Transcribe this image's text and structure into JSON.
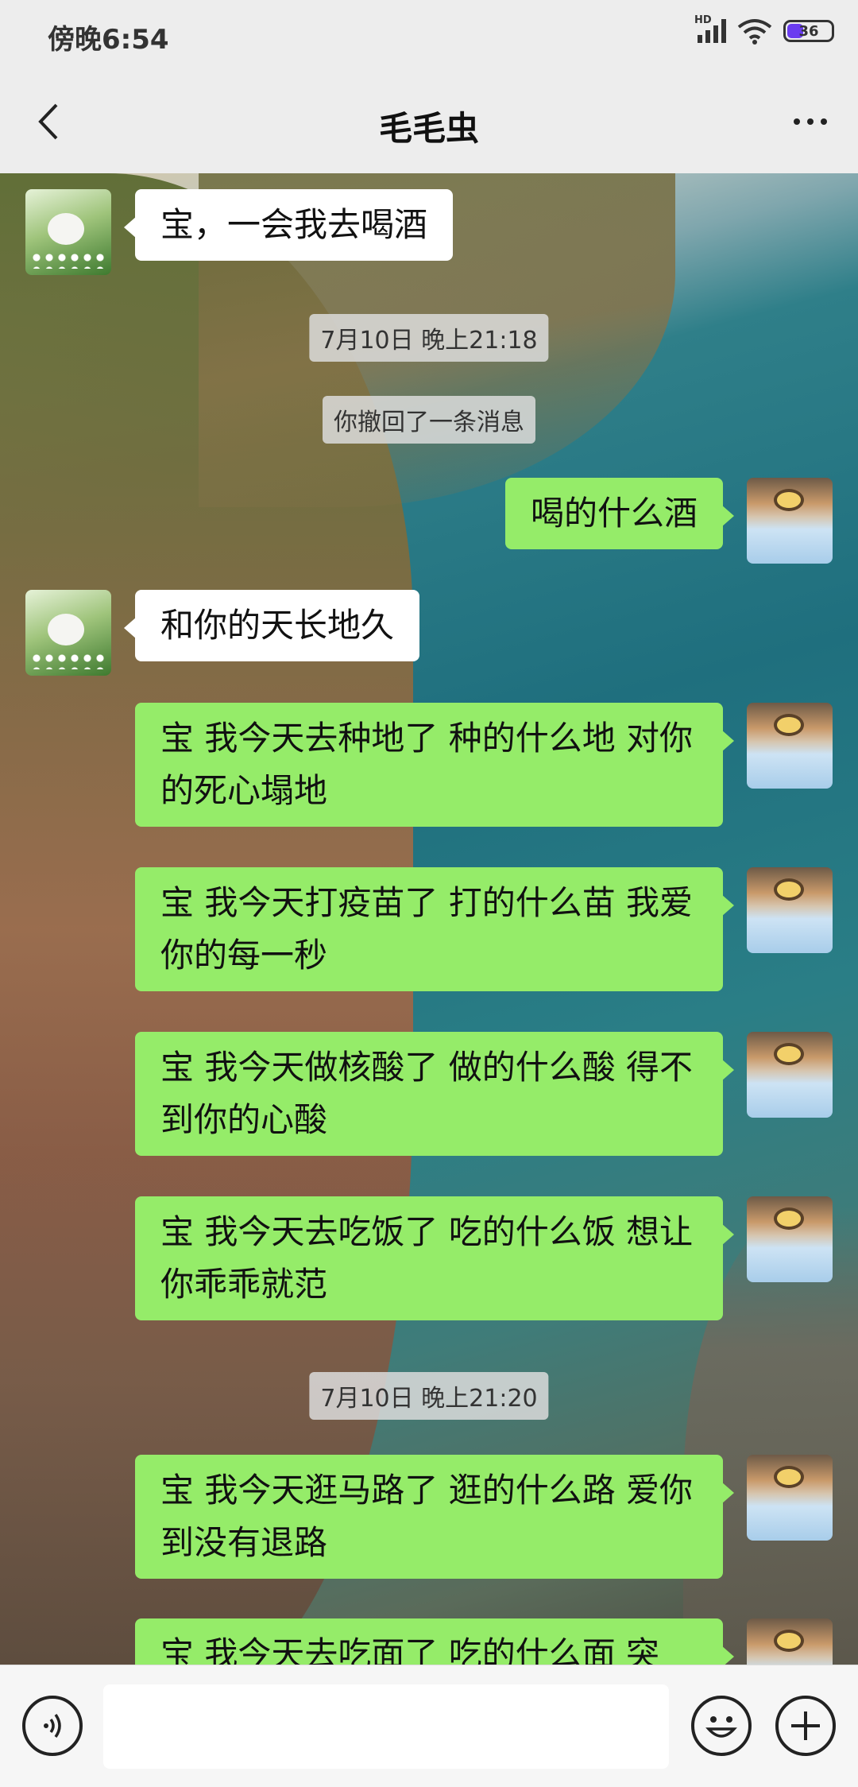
{
  "status_bar": {
    "time": "傍晚6:54",
    "network": "HD",
    "battery": "36"
  },
  "header": {
    "title": "毛毛虫",
    "back_icon": "chevron-left-icon",
    "more_icon": "more-dots-icon"
  },
  "messages": [
    {
      "type": "text",
      "side": "peer",
      "text": "宝，一会我去喝酒"
    },
    {
      "type": "time",
      "text": "7月10日 晚上21:18"
    },
    {
      "type": "system",
      "text": "你撤回了一条消息"
    },
    {
      "type": "text",
      "side": "me",
      "text": "喝的什么酒"
    },
    {
      "type": "text",
      "side": "peer",
      "text": "和你的天长地久"
    },
    {
      "type": "text",
      "side": "me",
      "text": "宝 我今天去种地了 种的什么地 对你的死心塌地"
    },
    {
      "type": "text",
      "side": "me",
      "text": "宝 我今天打疫苗了 打的什么苗 我爱你的每一秒"
    },
    {
      "type": "text",
      "side": "me",
      "text": "宝 我今天做核酸了 做的什么酸 得不到你的心酸"
    },
    {
      "type": "text",
      "side": "me",
      "text": "宝 我今天去吃饭了 吃的什么饭 想让你乖乖就范"
    },
    {
      "type": "time",
      "text": "7月10日 晚上21:20"
    },
    {
      "type": "text",
      "side": "me",
      "text": "宝 我今天逛马路了 逛的什么路 爱你到没有退路"
    },
    {
      "type": "text",
      "side": "me",
      "text": "宝 我今天去吃面了 吃的什么面 突"
    }
  ],
  "input_bar": {
    "voice_icon": "voice-icon",
    "input_value": "",
    "emoji_icon": "emoji-icon",
    "plus_icon": "plus-icon"
  },
  "colors": {
    "my_bubble": "#95ec69",
    "peer_bubble": "#ffffff",
    "bar_bg": "#ededed"
  }
}
